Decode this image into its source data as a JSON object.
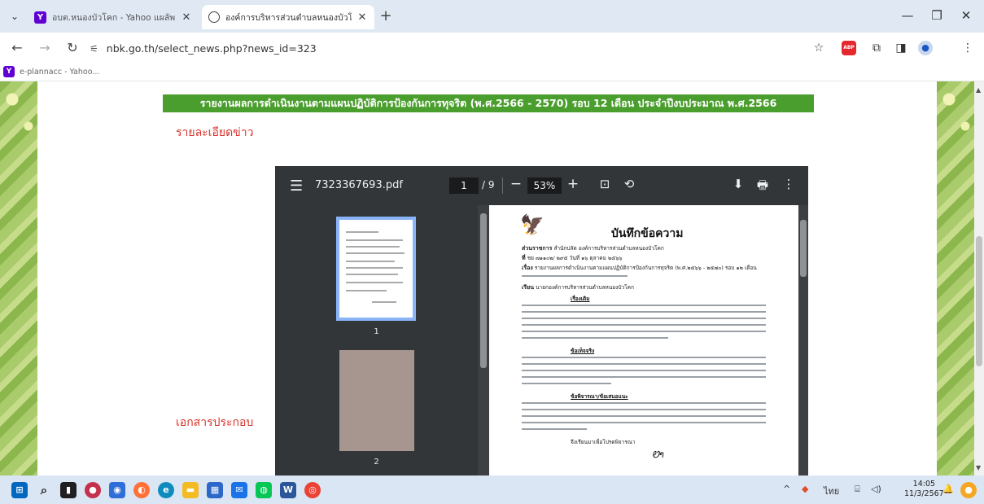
{
  "browser": {
    "tabs": [
      {
        "title": "อบต.หนองบัวโคก - Yahoo แผลัพธ์",
        "active": false,
        "favicon": "yahoo-icon"
      },
      {
        "title": "องค์การบริหารส่วนตำบลหนองบัวโค",
        "active": true,
        "favicon": "globe-icon"
      }
    ],
    "url": "nbk.go.th/select_news.php?news_id=323",
    "bookmark": "e-plannacc - Yahoo..."
  },
  "page": {
    "banner": "รายงานผลการดำเนินงานตามแผนปฏิบัติการป้องกันการทุจริต (พ.ศ.2566 - 2570) รอบ 12 เดือน ประจำปีงบประมาณ พ.ศ.2566",
    "details_label": "รายละเอียดข่าว",
    "attachments_label": "เอกสารประกอบ"
  },
  "pdf": {
    "filename": "7323367693.pdf",
    "page_current": "1",
    "page_total": "/ 9",
    "zoom": "53%",
    "thumb_labels": [
      "1",
      "2"
    ],
    "memo_title": "บันทึกข้อความ",
    "memo_rows": [
      {
        "label": "ส่วนราชการ",
        "text": "สำนักปลัด องค์การบริหารส่วนตำบลหนองบัวโคก"
      },
      {
        "label": "ที่",
        "text": "ชย ๗๑๑๐๒/  ๒๙๕              วันที่  ๑๖  ตุลาคม  ๒๕๖๖"
      },
      {
        "label": "เรื่อง",
        "text": "รายงานผลการดำเนินงานตามแผนปฏิบัติการป้องกันการทุจริต (พ.ศ.๒๕๖๖ - ๒๕๗๐) รอบ ๑๒ เดือน"
      },
      {
        "label": "เรียน",
        "text": "นายกองค์การบริหารส่วนตำบลหนองบัวโคก"
      }
    ],
    "memo_headings": [
      "เรื่องเดิม",
      "ข้อเท็จจริง",
      "ข้อพิจารณา/ข้อเสนอแนะ"
    ],
    "closing": "จึงเรียนมาเพื่อโปรดพิจารณา"
  },
  "taskbar": {
    "time": "14:05",
    "date": "11/3/2567",
    "lang": "ไทย"
  }
}
